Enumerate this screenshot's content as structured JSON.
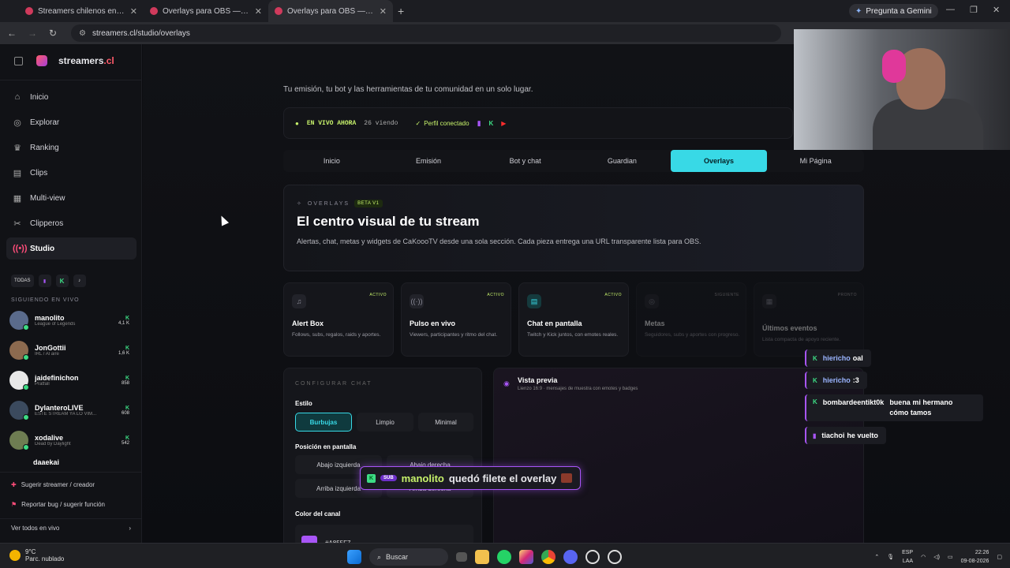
{
  "browser": {
    "tabs": [
      {
        "title": "Streamers chilenos en vivo | Tu"
      },
      {
        "title": "Overlays para OBS — Streamers"
      },
      {
        "title": "Overlays para OBS — Streamers"
      }
    ],
    "url": "streamers.cl/studio/overlays",
    "gemini": "Pregunta a Gemini"
  },
  "sidebar": {
    "brand": "streamers",
    "brand_suffix": ".cl",
    "nav": [
      "Inicio",
      "Explorar",
      "Ranking",
      "Clips",
      "Multi-view",
      "Clipperos",
      "Studio"
    ],
    "filters": [
      "TODAS"
    ],
    "following_heading": "SIGUIENDO EN VIVO",
    "streamers": [
      {
        "name": "manolito",
        "game": "League of Legends",
        "viewers": "4,1 K"
      },
      {
        "name": "JonGottii",
        "game": "IRL / Al aire",
        "viewers": "1,6 K"
      },
      {
        "name": "jaidefinichon",
        "game": "Pratfall",
        "viewers": "858"
      },
      {
        "name": "DylanteroLIVE",
        "game": "ESTE STREAM YA LO VIM...",
        "viewers": "608"
      },
      {
        "name": "xodalive",
        "game": "Dead by Daylight",
        "viewers": "542"
      },
      {
        "name": "daaekai",
        "game": "",
        "viewers": ""
      }
    ],
    "footer": [
      "Sugerir streamer / creador",
      "Reportar bug / sugerir función",
      "Ver todos en vivo"
    ]
  },
  "main": {
    "subtitle": "Tu emisión, tu bot y las herramientas de tu comunidad en un solo lugar.",
    "live_label": "EN VIVO AHORA",
    "viewers": "26 viendo",
    "profile": "Perfil conectado",
    "tabs": [
      "Inicio",
      "Emisión",
      "Bot y chat",
      "Guardian",
      "Overlays",
      "Mi Página"
    ],
    "hero": {
      "kicker": "OVERLAYS",
      "beta": "BETA V1",
      "title": "El centro visual de tu stream",
      "desc": "Alertas, chat, metas y widgets de CaKoooTV desde una sola sección. Cada pieza entrega una URL transparente lista para OBS."
    },
    "cards": [
      {
        "title": "Alert Box",
        "desc": "Follows, subs, regalos, raids y aportes.",
        "badge": "ACTIVO"
      },
      {
        "title": "Pulso en vivo",
        "desc": "Viewers, participantes y ritmo del chat.",
        "badge": "ACTIVO"
      },
      {
        "title": "Chat en pantalla",
        "desc": "Twitch y Kick juntos, con emotes reales.",
        "badge": "ACTIVO"
      },
      {
        "title": "Metas",
        "desc": "Seguidores, subs y aportes con progreso.",
        "badge": "SIGUIENTE"
      },
      {
        "title": "Últimos eventos",
        "desc": "Lista compacta de apoyo reciente.",
        "badge": "PRONTO"
      }
    ],
    "config": {
      "heading": "CONFIGURAR CHAT",
      "style_label": "Estilo",
      "styles": [
        "Burbujas",
        "Limpio",
        "Minimal"
      ],
      "position_label": "Posición en pantalla",
      "positions": [
        "Abajo izquierda",
        "Abajo derecha",
        "Arriba izquierda",
        "Arriba derecha"
      ],
      "color_label": "Color del canal",
      "color": "#A855F7"
    },
    "preview": {
      "title": "Vista previa",
      "desc": "Lienzo 16:9 · mensajes de muestra con emotes y badges",
      "toast_user": "manolito",
      "toast_msg": "quedó filete el overlay",
      "toast_badge": "SUB"
    }
  },
  "chat_overlay": [
    {
      "user": "hiericho",
      "msg": "oal",
      "platform": "K"
    },
    {
      "user": "hiericho",
      "msg": ":3",
      "platform": "K"
    },
    {
      "user": "bombardeentikt0k",
      "msg": "buena mi hermano cómo tamos",
      "platform": "K"
    },
    {
      "user": "tiachoi",
      "msg": "he vuelto",
      "platform": "twitch"
    }
  ],
  "taskbar": {
    "temp": "9°C",
    "weather": "Parc. nublado",
    "search": "Buscar",
    "lang": "ESP",
    "lang2": "LAA",
    "time": "22:26",
    "date": "09-08-2026"
  }
}
